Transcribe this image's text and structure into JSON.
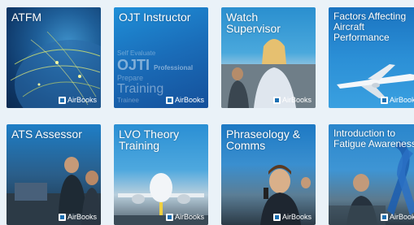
{
  "brand": "AirBooks",
  "tiles": [
    {
      "title": "ATFM"
    },
    {
      "title": "OJT Instructor",
      "watermark": [
        "Self Evaluate",
        "OJTI",
        "Professional",
        "Prepare",
        "Training",
        "Trainee"
      ]
    },
    {
      "title": "Watch Supervisor"
    },
    {
      "title": "Factors Affecting Aircraft Performance"
    },
    {
      "title": "ATS Assessor"
    },
    {
      "title": "LVO Theory Training"
    },
    {
      "title": "Phraseology & Comms"
    },
    {
      "title": "Introduction to Fatigue Awareness"
    }
  ]
}
